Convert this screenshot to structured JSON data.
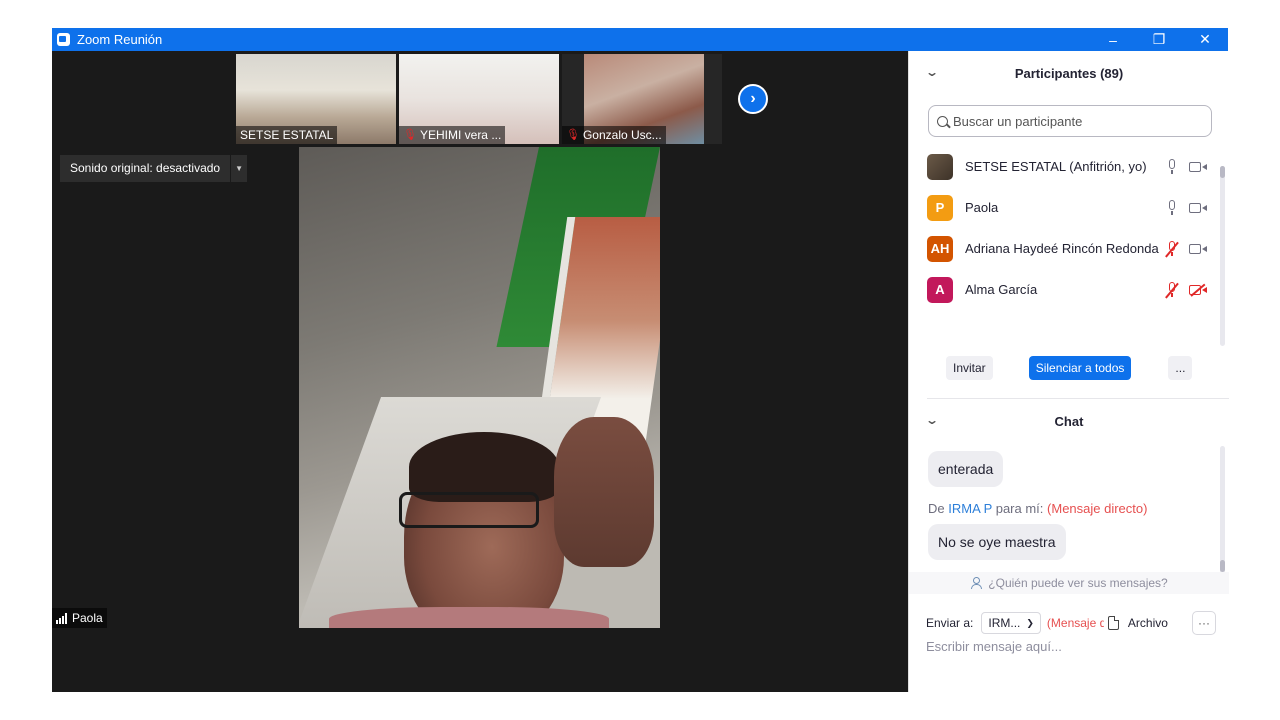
{
  "window": {
    "title": "Zoom Reunión"
  },
  "colors": {
    "accent": "#0e71eb",
    "muted_red": "#e02828",
    "direct_message": "#e65050",
    "stage_bg": "#1a1a1a"
  },
  "thumbnails": [
    {
      "name": "SETSE ESTATAL",
      "muted": false
    },
    {
      "name": "YEHIMI vera ...",
      "muted": true
    },
    {
      "name": "Gonzalo Usc...",
      "muted": true
    }
  ],
  "next_icon": "chevron-right-icon",
  "sound_button": {
    "label": "Sonido original: desactivado"
  },
  "active_speaker": {
    "name": "Paola"
  },
  "participants": {
    "title": "Participantes (89)",
    "search_placeholder": "Buscar un participante",
    "list": [
      {
        "name": "SETSE ESTATAL (Anfitrión, yo)",
        "avatar_type": "photo",
        "avatar_color": "#5a4a3a",
        "mic_muted": false,
        "video_off": false
      },
      {
        "name": "Paola",
        "avatar_initials": "P",
        "avatar_color": "#f39c12",
        "mic_muted": false,
        "video_off": false
      },
      {
        "name": "Adriana Haydeé Rincón Redonda",
        "avatar_initials": "AH",
        "avatar_color": "#d35400",
        "mic_muted": true,
        "video_off": false
      },
      {
        "name": "Alma García",
        "avatar_initials": "A",
        "avatar_color": "#c2185b",
        "mic_muted": true,
        "video_off": true
      }
    ],
    "buttons": {
      "invite": "Invitar",
      "mute_all": "Silenciar a todos",
      "more": "..."
    }
  },
  "chat": {
    "title": "Chat",
    "messages": [
      {
        "text": "enterada"
      },
      {
        "from_prefix": "De",
        "sender": "IRMA P",
        "to_text": "para mí:",
        "direct_label": "(Mensaje directo)",
        "text": "No se oye maestra"
      }
    ],
    "who_can_see": "¿Quién puede ver sus mensajes?",
    "send_to_label": "Enviar a:",
    "send_to_value": "IRM...",
    "send_to_direct": "(Mensaje directo)",
    "file_label": "Archivo",
    "more_label": "···",
    "input_placeholder": "Escribir mensaje aquí..."
  }
}
